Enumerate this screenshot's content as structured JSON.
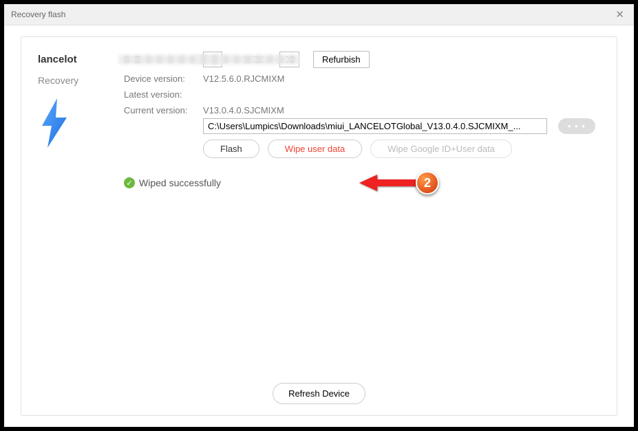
{
  "window": {
    "title": "Recovery flash"
  },
  "device": {
    "name": "lancelot",
    "mode": "Recovery"
  },
  "labels": {
    "imei": "IMEI:",
    "imei2": "IMEI2:",
    "device_version": "Device version:",
    "latest_version": "Latest version:",
    "current_version": "Current version:"
  },
  "values": {
    "imei_prefix": "86",
    "imei2_prefix": "86",
    "device_version": "V12.5.6.0.RJCMIXM",
    "latest_version": "",
    "current_version": "V13.0.4.0.SJCMIXM",
    "path": "C:\\Users\\Lumpics\\Downloads\\miui_LANCELOTGlobal_V13.0.4.0.SJCMIXM_..."
  },
  "buttons": {
    "refurbish": "Refurbish",
    "dots": "• • •",
    "flash": "Flash",
    "wipe_user": "Wipe user data",
    "wipe_google": "Wipe Google ID+User data",
    "refresh": "Refresh Device"
  },
  "status": {
    "message": "Wiped successfully"
  },
  "annotation": {
    "number": "2"
  }
}
